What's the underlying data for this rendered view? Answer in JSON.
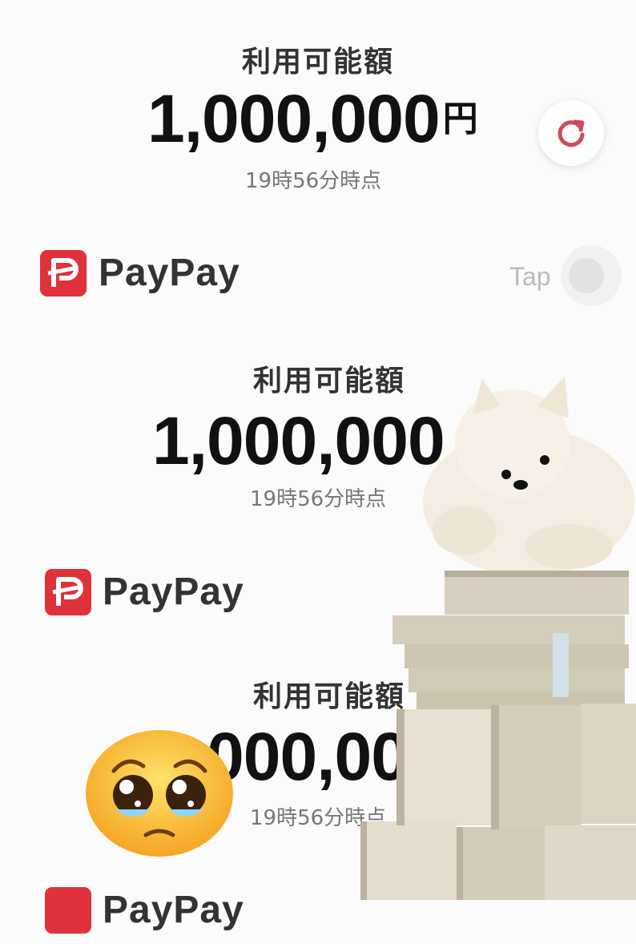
{
  "wallet_card": {
    "balance_label": "利用可能額",
    "amount": "1,000,000",
    "currency": "円",
    "timestamp": "19時56分時点",
    "refresh_icon": "refresh-icon",
    "accent_color": "#e0323c"
  },
  "brand": {
    "name": "PayPay",
    "logo_icon": "paypay-logo-icon"
  },
  "tap_control": {
    "label": "Tap"
  },
  "repeat_card_2": {
    "balance_label": "利用可能額",
    "amount": "1,000,000",
    "timestamp": "19時56分時点"
  },
  "repeat_card_3": {
    "balance_label": "利用可能額",
    "amount": "1,000,00",
    "timestamp": "19時56分時点"
  },
  "stickers": {
    "dog": "pomeranian-dog-image",
    "money": "cash-stack-image",
    "emoji": "pleading-face-emoji"
  }
}
